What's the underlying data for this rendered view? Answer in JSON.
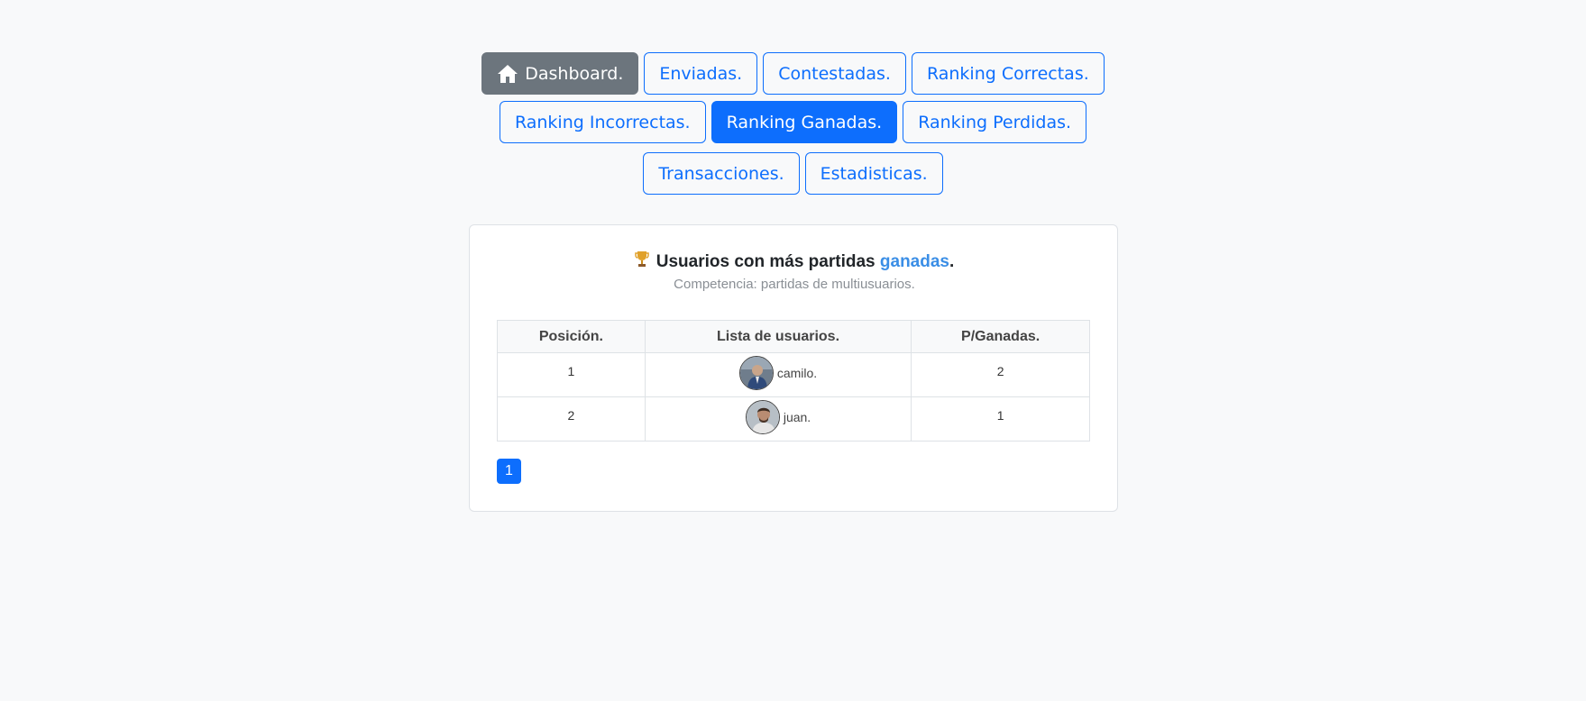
{
  "nav": {
    "dashboard": "Dashboard.",
    "enviadas": "Enviadas.",
    "contestadas": "Contestadas.",
    "ranking_correctas": "Ranking Correctas.",
    "ranking_incorrectas": "Ranking Incorrectas.",
    "ranking_ganadas": "Ranking Ganadas.",
    "ranking_perdidas": "Ranking Perdidas.",
    "transacciones": "Transacciones.",
    "estadisticas": "Estadisticas."
  },
  "card": {
    "title_prefix": "Usuarios con más partidas ",
    "title_accent": "ganadas",
    "title_suffix": ".",
    "subtitle": "Competencia: partidas de multiusuarios."
  },
  "table": {
    "headers": [
      "Posición.",
      "Lista de usuarios.",
      "P/Ganadas."
    ],
    "rows": [
      {
        "position": "1",
        "user": "camilo.",
        "wins": "2"
      },
      {
        "position": "2",
        "user": "juan.",
        "wins": "1"
      }
    ]
  },
  "pagination": {
    "current": "1"
  },
  "colors": {
    "primary": "#0d6efd",
    "secondary": "#6c757d",
    "accent": "#3a8ee6",
    "background": "#f8f9fa"
  },
  "icons": {
    "dashboard": "home-icon",
    "title": "trophy-icon"
  }
}
